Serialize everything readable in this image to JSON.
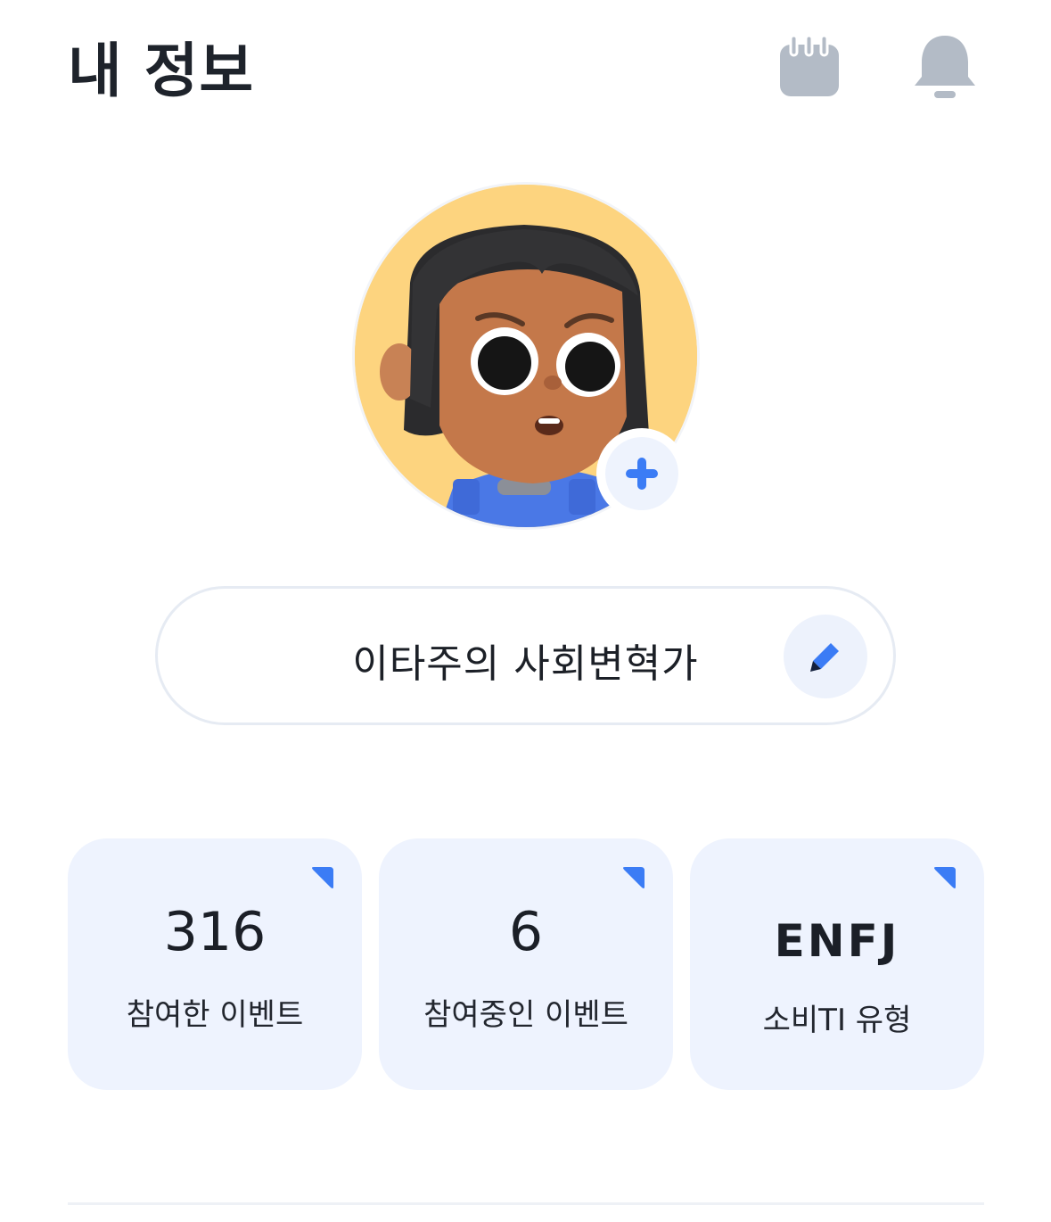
{
  "header": {
    "title": "내 정보",
    "calendar_icon": "calendar-icon",
    "bell_icon": "bell-icon",
    "icon_color": "#b3bbc6"
  },
  "profile": {
    "avatar": "character-avatar",
    "add_photo_icon": "plus-icon",
    "nickname": "이타주의 사회변혁가",
    "edit_icon": "pencil-icon",
    "accent": "#3b7cf5"
  },
  "stats": [
    {
      "value": "316",
      "label": "참여한 이벤트"
    },
    {
      "value": "6",
      "label": "참여중인 이벤트"
    },
    {
      "value": "ENFJ",
      "label": "소비TI 유형"
    }
  ]
}
